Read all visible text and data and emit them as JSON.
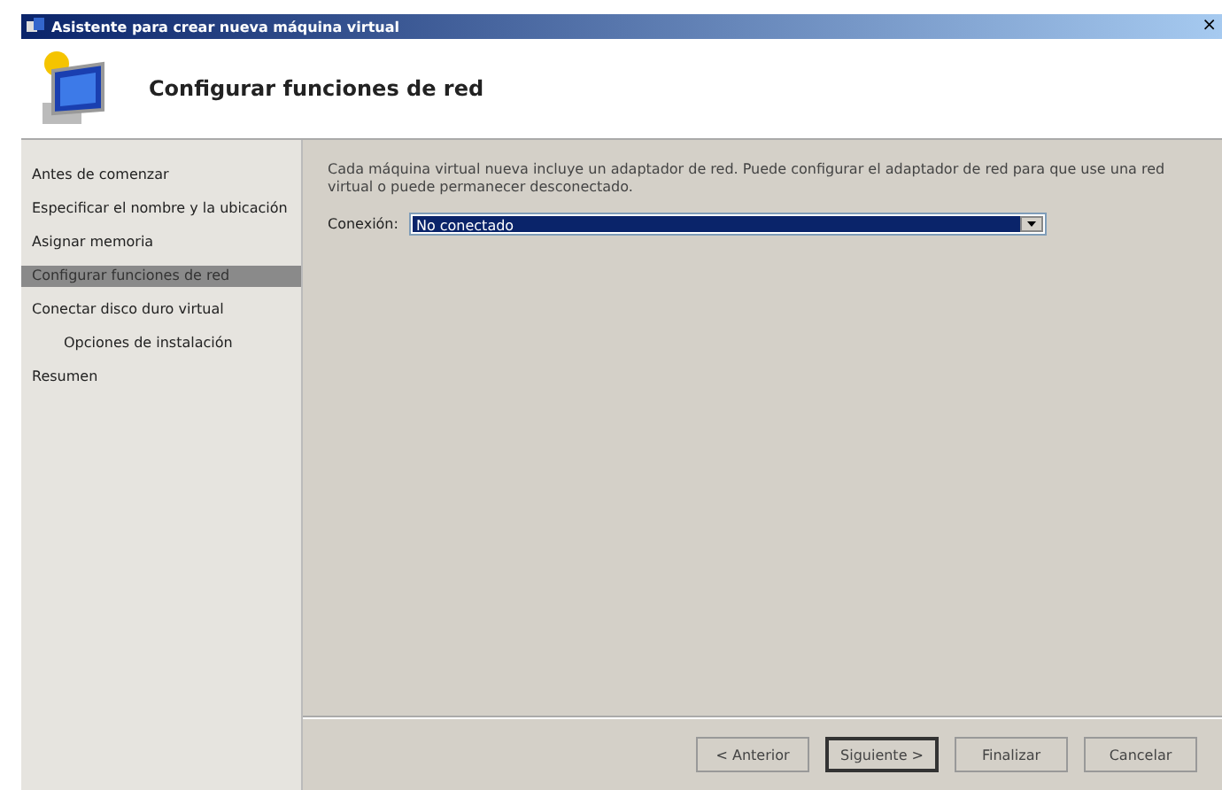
{
  "window": {
    "title": "Asistente para crear nueva máquina virtual",
    "close": "×"
  },
  "header": {
    "title": "Configurar funciones de red"
  },
  "steps": [
    {
      "label": "Antes de comenzar",
      "selected": false
    },
    {
      "label": "Especificar el nombre y la ubicación",
      "selected": false
    },
    {
      "label": "Asignar memoria",
      "selected": false
    },
    {
      "label": "Configurar funciones de red",
      "selected": true
    },
    {
      "label": "Conectar disco duro virtual",
      "selected": false,
      "children": [
        {
          "label": "Opciones de instalación",
          "selected": false
        }
      ]
    },
    {
      "label": "Resumen",
      "selected": false
    }
  ],
  "description": "Cada máquina virtual nueva incluye un adaptador de red. Puede configurar el adaptador de red para que use una red virtual o puede permanecer desconectado.",
  "connection": {
    "label": "Conexión:",
    "value": "No conectado"
  },
  "buttons": [
    {
      "label": "< Anterior",
      "default": false
    },
    {
      "label": "Siguiente >",
      "default": true
    },
    {
      "label": "Finalizar",
      "default": false
    },
    {
      "label": "Cancelar",
      "default": false
    }
  ]
}
